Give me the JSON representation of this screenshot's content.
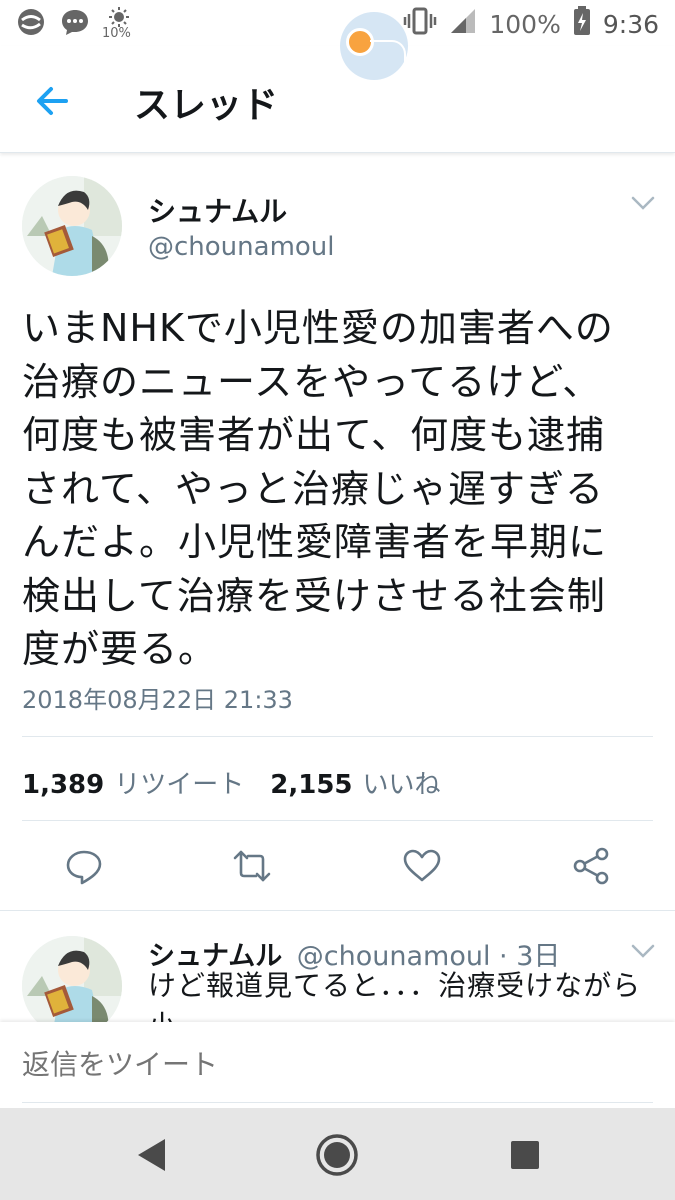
{
  "status_bar": {
    "icons_left": [
      "sync-icon",
      "chat-bubble-icon",
      "brightness-icon"
    ],
    "brightness_label": "10%",
    "icons_right": [
      "vibrate-icon",
      "signal-icon",
      "battery-charging-icon"
    ],
    "battery": "100%",
    "time": "9:36"
  },
  "header": {
    "title": "スレッド",
    "back_icon": "back-arrow-icon",
    "accent_color": "#1da1f2"
  },
  "tweet": {
    "author_name": "シュナムル",
    "author_handle": "@chounamoul",
    "text": "いまNHKで小児性愛の加害者への\n治療のニュースをやってるけど、\n何度も被害者が出て、何度も逮捕\nされて、やっと治療じゃ遅すぎる\nんだよ。小児性愛障害者を早期に\n検出して治療を受けさせる社会制\n度が要る。",
    "timestamp": "2018年08月22日 21:33",
    "retweet_count": "1,389",
    "retweet_label": "リツイート",
    "like_count": "2,155",
    "like_label": "いいね",
    "actions": [
      "reply-icon",
      "retweet-icon",
      "like-icon",
      "share-icon"
    ]
  },
  "reply": {
    "author_name": "シュナムル",
    "meta": "@chounamoul · 3日",
    "text": "けど報道見てると．．．治療受けながら小\n中学生とSNSで接触を図ったり、家に小"
  },
  "compose": {
    "placeholder": "返信をツイート"
  },
  "nav_bar": {
    "buttons": [
      "back-triangle-icon",
      "home-circle-icon",
      "recents-square-icon"
    ]
  }
}
